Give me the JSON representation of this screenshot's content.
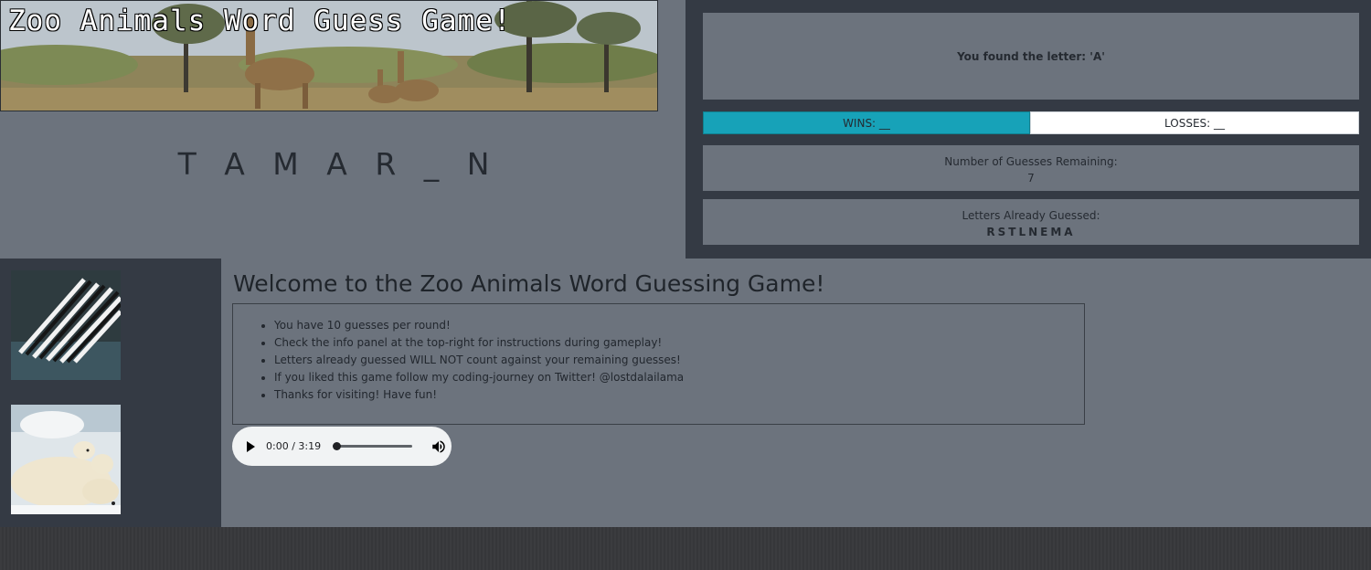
{
  "banner": {
    "title": "Zoo Animals Word Guess Game!"
  },
  "word": {
    "display": "T A M A R _ N"
  },
  "info": {
    "message": "You found the letter: 'A'",
    "wins_label": "WINS: __",
    "losses_label": "LOSSES: __",
    "guesses_label": "Number of Guesses Remaining:",
    "guesses_value": "7",
    "letters_label": "Letters Already Guessed:",
    "letters_value": "RSTLNEMA"
  },
  "main": {
    "welcome": "Welcome to the Zoo Animals Word Guessing Game!",
    "rules": [
      "You have 10 guesses per round!",
      "Check the info panel at the top-right for instructions during gameplay!",
      "Letters already guessed WILL NOT count against your remaining guesses!",
      "If you liked this game follow my coding-journey on Twitter! @lostdalailama",
      "Thanks for visiting! Have fun!"
    ]
  },
  "audio": {
    "time": "0:00 / 3:19",
    "progress": 0
  },
  "colors": {
    "accent": "#17a2b8",
    "panel": "#6c737d",
    "dark": "#343a44"
  },
  "icons": {
    "play": "play-icon",
    "volume": "volume-icon"
  }
}
